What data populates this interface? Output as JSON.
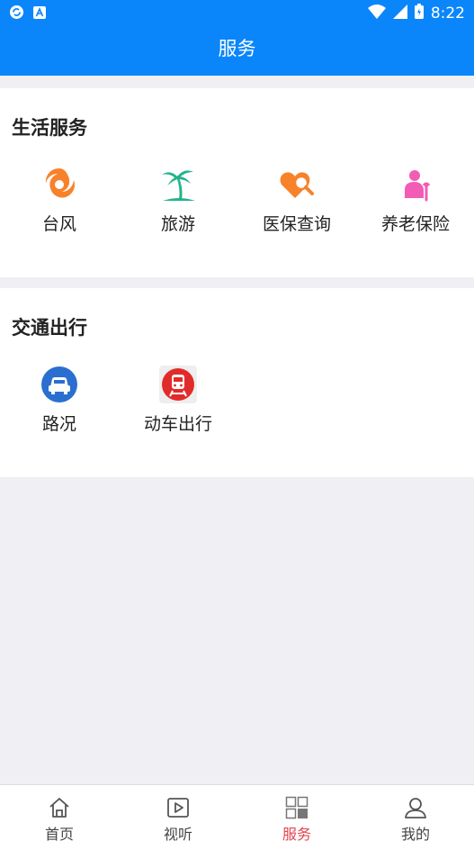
{
  "status_bar": {
    "time": "8:22",
    "icons": [
      "sync-icon",
      "a-icon",
      "wifi-icon",
      "signal-icon",
      "battery-icon"
    ]
  },
  "header": {
    "title": "服务"
  },
  "sections": [
    {
      "title": "生活服务",
      "items": [
        {
          "label": "台风",
          "icon": "typhoon-icon",
          "color": "#f7822a"
        },
        {
          "label": "旅游",
          "icon": "palm-tree-icon",
          "color": "#22b38c"
        },
        {
          "label": "医保查询",
          "icon": "medical-insurance-icon",
          "color": "#f7822a"
        },
        {
          "label": "养老保险",
          "icon": "elderly-icon",
          "color": "#f25cb4"
        }
      ]
    },
    {
      "title": "交通出行",
      "items": [
        {
          "label": "路况",
          "icon": "car-icon",
          "color": "#2a6fd0"
        },
        {
          "label": "动车出行",
          "icon": "train-icon",
          "color": "#e12b2b"
        }
      ]
    }
  ],
  "tabbar": {
    "items": [
      {
        "label": "首页",
        "icon": "home-icon"
      },
      {
        "label": "视听",
        "icon": "play-icon"
      },
      {
        "label": "服务",
        "icon": "grid-icon",
        "active": true
      },
      {
        "label": "我的",
        "icon": "user-icon"
      }
    ],
    "active_color": "#e0454f"
  },
  "colors": {
    "header_bg": "#0a86fa",
    "page_bg": "#efeff4"
  }
}
